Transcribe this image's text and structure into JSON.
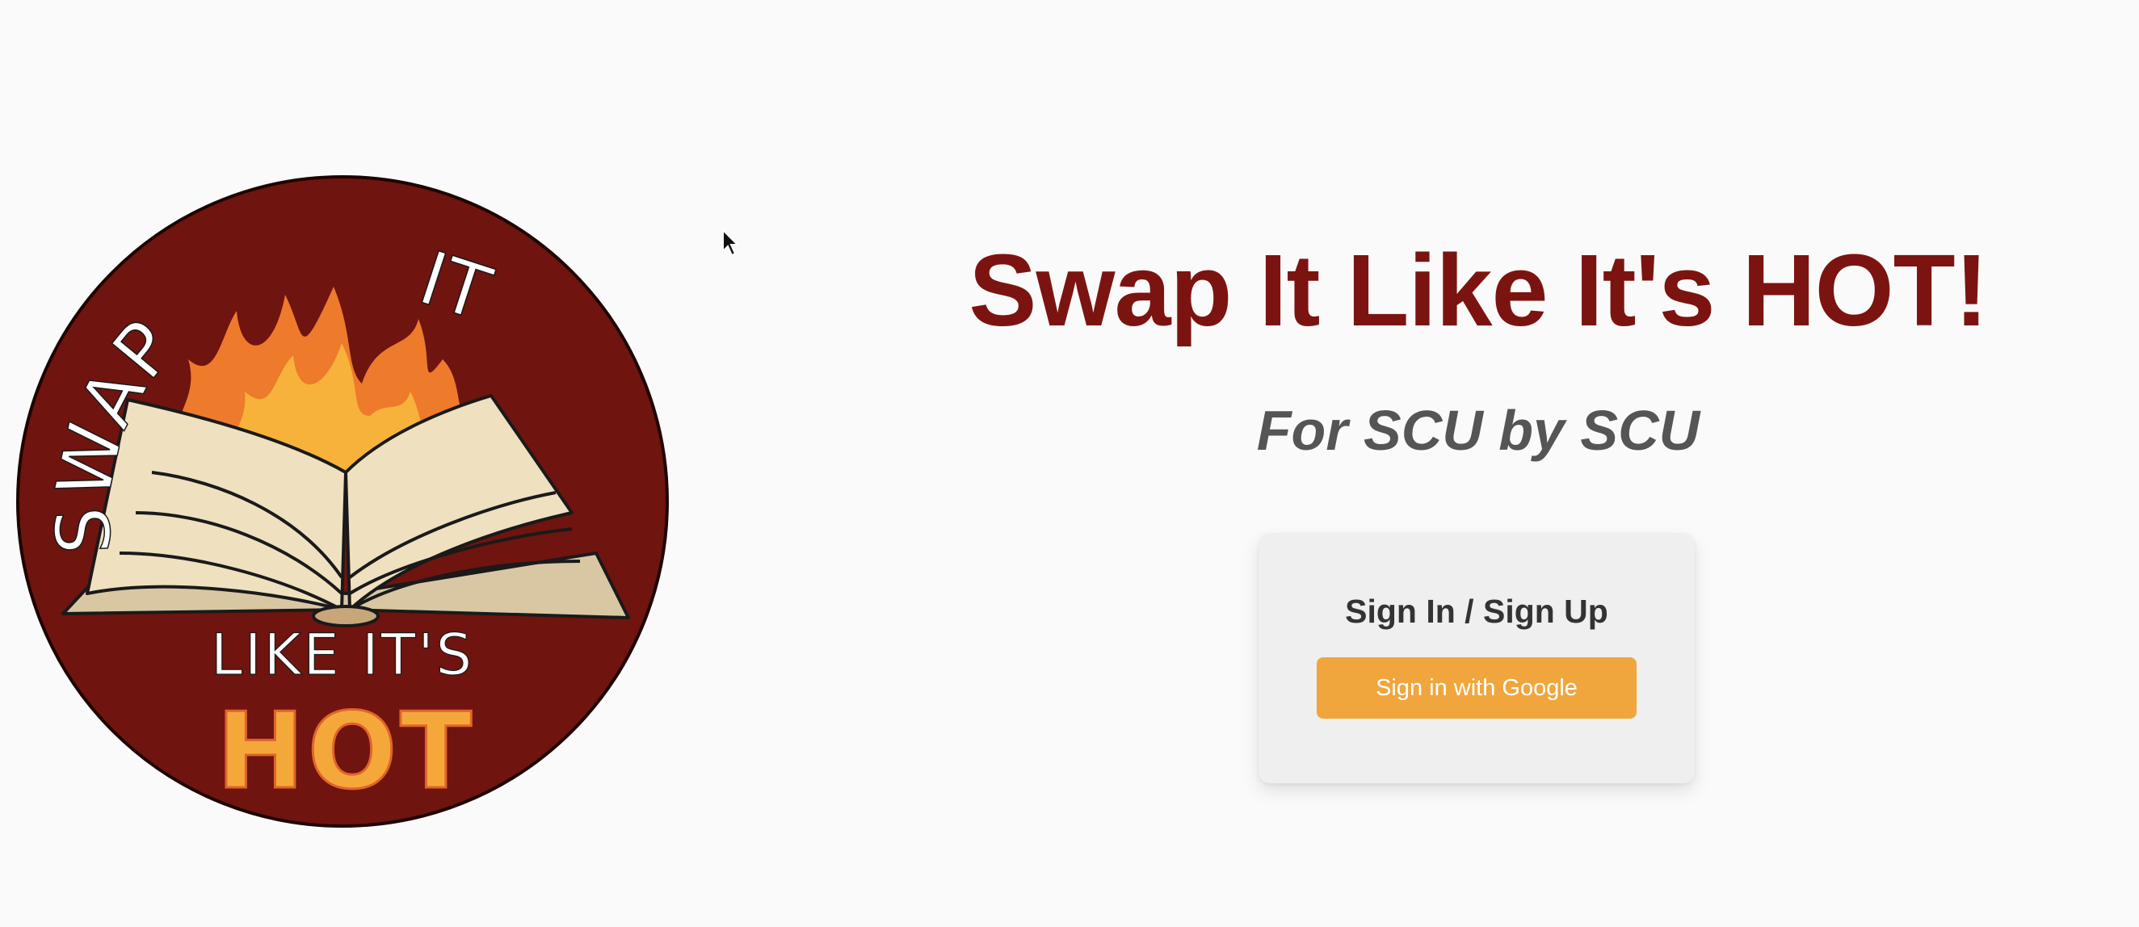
{
  "logo": {
    "text_top_left": "SWAP",
    "text_top_right": "IT",
    "text_middle": "LIKE IT'S",
    "text_bottom": "HOT",
    "colors": {
      "disc": "#6f140f",
      "flame_outer": "#ee7a2b",
      "flame_inner": "#f7b23b",
      "pages": "#efe0bf",
      "lettering": "#ffffff",
      "hot_lettering": "#f4a83a"
    }
  },
  "hero": {
    "title": "Swap It Like It's HOT!",
    "subtitle": "For SCU by SCU"
  },
  "auth": {
    "heading": "Sign In / Sign Up",
    "google_button_label": "Sign in with Google"
  },
  "colors": {
    "brand": "#7b1410",
    "accent": "#f0a63d",
    "background": "#fafafa",
    "card": "#efefef"
  }
}
